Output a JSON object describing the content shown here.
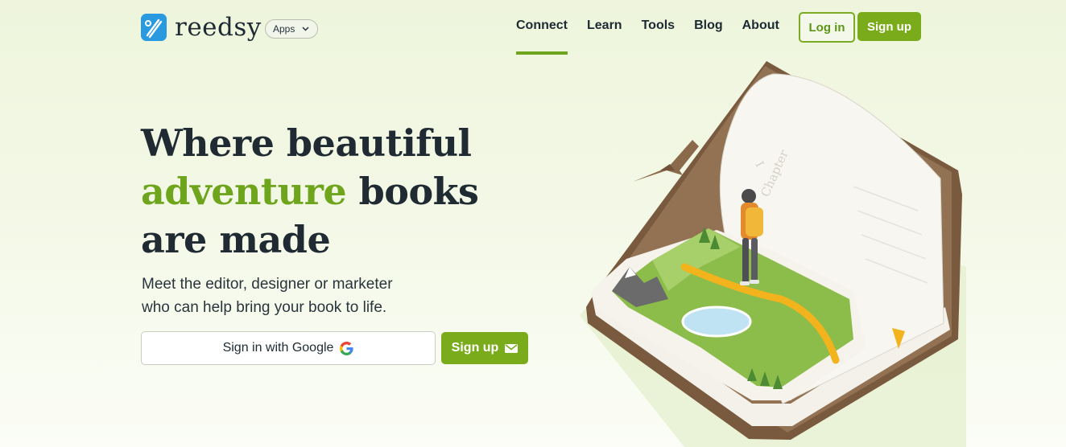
{
  "header": {
    "logo_text": "reedsy",
    "apps_label": "Apps",
    "nav": [
      {
        "label": "Connect",
        "active": true
      },
      {
        "label": "Learn",
        "active": false
      },
      {
        "label": "Tools",
        "active": false
      },
      {
        "label": "Blog",
        "active": false
      },
      {
        "label": "About",
        "active": false
      }
    ],
    "login_label": "Log in",
    "signup_label": "Sign up"
  },
  "hero": {
    "title_line1": "Where beautiful",
    "title_accent": "adventure",
    "title_line2_rest": " books",
    "title_line3": "are made",
    "subtitle_line1": "Meet the editor, designer or marketer",
    "subtitle_line2": "who can help bring your book to life.",
    "google_button_label": "Sign in with Google",
    "signup_button_label": "Sign up",
    "chapter_text": "Chapter",
    "chapter_number": "I"
  },
  "colors": {
    "accent": "#7aab1a",
    "text": "#1e2a33",
    "logo_blue": "#2a9ae0"
  },
  "icons": [
    "reedsy-logo-icon",
    "chevron-down-icon",
    "google-icon",
    "mail-icon"
  ]
}
